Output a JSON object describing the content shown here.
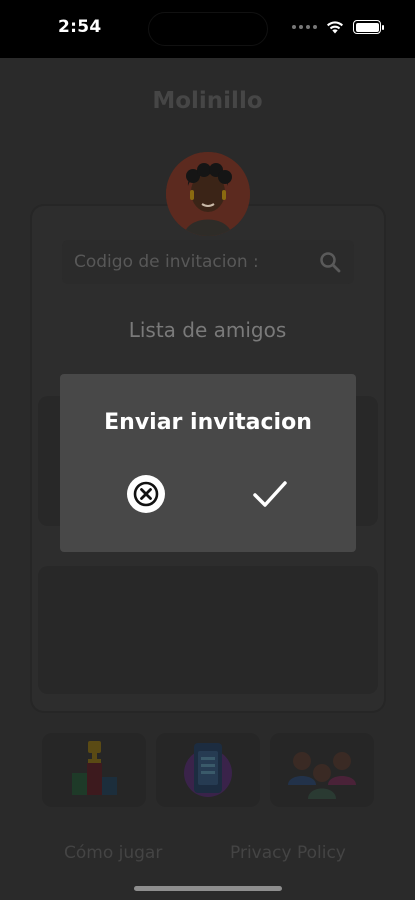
{
  "status_bar": {
    "time": "2:54"
  },
  "app": {
    "title": "Molinillo"
  },
  "search": {
    "placeholder": "Codigo de invitacion :"
  },
  "friends": {
    "title": "Lista de amigos"
  },
  "dialog": {
    "title": "Enviar invitacion"
  },
  "tiles": [
    {
      "icon": "podium-icon"
    },
    {
      "icon": "phone-app-icon"
    },
    {
      "icon": "people-group-icon"
    }
  ],
  "links": {
    "how_to_play": "Cómo jugar",
    "privacy_policy": "Privacy Policy"
  },
  "colors": {
    "dialog_bg": "#484848",
    "overlay": "#2a2a2a",
    "status_bar": "#000000"
  }
}
